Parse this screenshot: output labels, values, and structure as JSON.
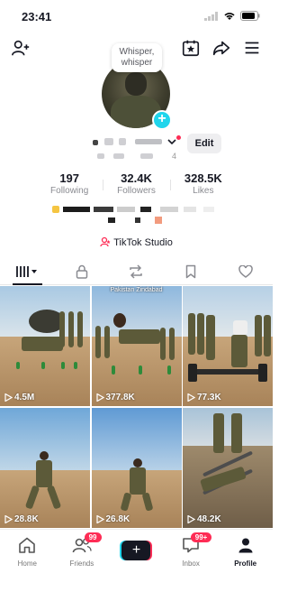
{
  "status": {
    "time": "23:41"
  },
  "profile": {
    "bubble": "Whisper, whisper",
    "edit_label": "Edit",
    "stats": [
      {
        "value": "197",
        "label": "Following"
      },
      {
        "value": "32.4K",
        "label": "Followers"
      },
      {
        "value": "328.5K",
        "label": "Likes"
      }
    ],
    "studio_label": "TikTok Studio",
    "digit": "4"
  },
  "videos": [
    {
      "views": "4.5M",
      "overlay": ""
    },
    {
      "views": "377.8K",
      "overlay": "Pakistan Zindabad"
    },
    {
      "views": "77.3K",
      "overlay": ""
    },
    {
      "views": "28.8K",
      "overlay": ""
    },
    {
      "views": "26.8K",
      "overlay": ""
    },
    {
      "views": "48.2K",
      "overlay": ""
    }
  ],
  "nav": [
    {
      "label": "Home",
      "icon": "home-icon"
    },
    {
      "label": "Friends",
      "icon": "friends-icon",
      "badge": "99"
    },
    {
      "label": "",
      "icon": "create-icon"
    },
    {
      "label": "Inbox",
      "icon": "inbox-icon",
      "badge": "99+"
    },
    {
      "label": "Profile",
      "icon": "profile-icon"
    }
  ],
  "colors": {
    "accent": "#fe2c55",
    "cyan": "#20d5ec",
    "text": "#161823"
  }
}
